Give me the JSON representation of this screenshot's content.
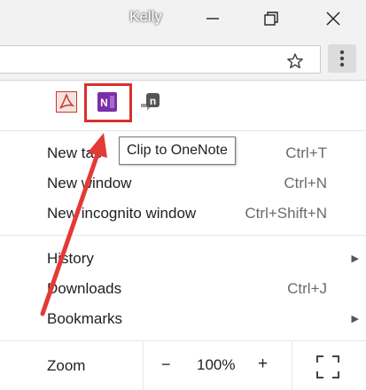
{
  "window": {
    "user_name": "Kelly",
    "controls": [
      "minimize",
      "maximize",
      "close"
    ]
  },
  "toolbar": {
    "icons": [
      "star-icon",
      "more-vert-icon"
    ]
  },
  "extensions": [
    {
      "name": "acrobat",
      "icon": "acrobat-icon"
    },
    {
      "name": "onenote",
      "icon": "onenote-icon",
      "highlighted": true
    },
    {
      "name": "clipper",
      "icon": "clipper-icon"
    }
  ],
  "tooltip": "Clip to OneNote",
  "menu": {
    "new_tab": {
      "label": "New tab",
      "shortcut": "Ctrl+T"
    },
    "new_window": {
      "label": "New window",
      "shortcut": "Ctrl+N"
    },
    "new_incognito": {
      "label": "New incognito window",
      "shortcut": "Ctrl+Shift+N"
    },
    "history": {
      "label": "History"
    },
    "downloads": {
      "label": "Downloads",
      "shortcut": "Ctrl+J"
    },
    "bookmarks": {
      "label": "Bookmarks"
    },
    "zoom": {
      "label": "Zoom",
      "minus": "−",
      "value": "100%",
      "plus": "+"
    }
  },
  "colors": {
    "highlight": "#d9302c",
    "onenote": "#7b2fa6",
    "acrobat": "#c8392b"
  }
}
